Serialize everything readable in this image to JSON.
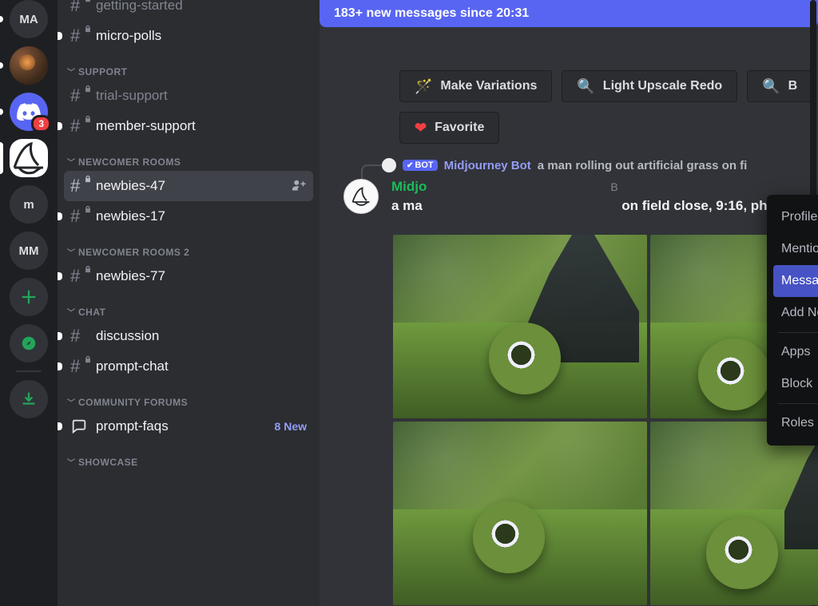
{
  "servers": {
    "s1_initials": "MA",
    "s3_alt": "Ai A",
    "s3_badge": "3",
    "s5_initials": "m",
    "s6_initials": "MM"
  },
  "sidebar": {
    "cat_support": "SUPPORT",
    "cat_newcomer": "NEWCOMER ROOMS",
    "cat_newcomer2": "NEWCOMER ROOMS 2",
    "cat_chat": "CHAT",
    "cat_forums": "COMMUNITY FORUMS",
    "cat_showcase": "SHOWCASE",
    "ch_getting_started": "getting-started",
    "ch_micro_polls": "micro-polls",
    "ch_trial_support": "trial-support",
    "ch_member_support": "member-support",
    "ch_newbies_47": "newbies-47",
    "ch_newbies_17": "newbies-17",
    "ch_newbies_77": "newbies-77",
    "ch_discussion": "discussion",
    "ch_prompt_chat": "prompt-chat",
    "ch_prompt_faqs": "prompt-faqs",
    "prompt_faqs_new": "8 New"
  },
  "newbar": "183+ new messages since 20:31",
  "buttons": {
    "make_variations": "Make Variations",
    "light_upscale": "Light Upscale Redo",
    "b_partial": "B",
    "favorite": "Favorite"
  },
  "reply": {
    "bot_tag": "BOT",
    "bot_name": "Midjourney Bot",
    "text": "a man rolling out artificial grass on fi"
  },
  "message": {
    "username_partial": "Midjo",
    "ts_partial": "B",
    "prompt_prefix": "a ma",
    "prompt_suffix": "on field close, 9:16, ph"
  },
  "context_menu": {
    "profile": "Profile",
    "mention": "Mention",
    "message": "Message",
    "add_note": "Add Note",
    "apps": "Apps",
    "block": "Block",
    "roles": "Roles"
  }
}
